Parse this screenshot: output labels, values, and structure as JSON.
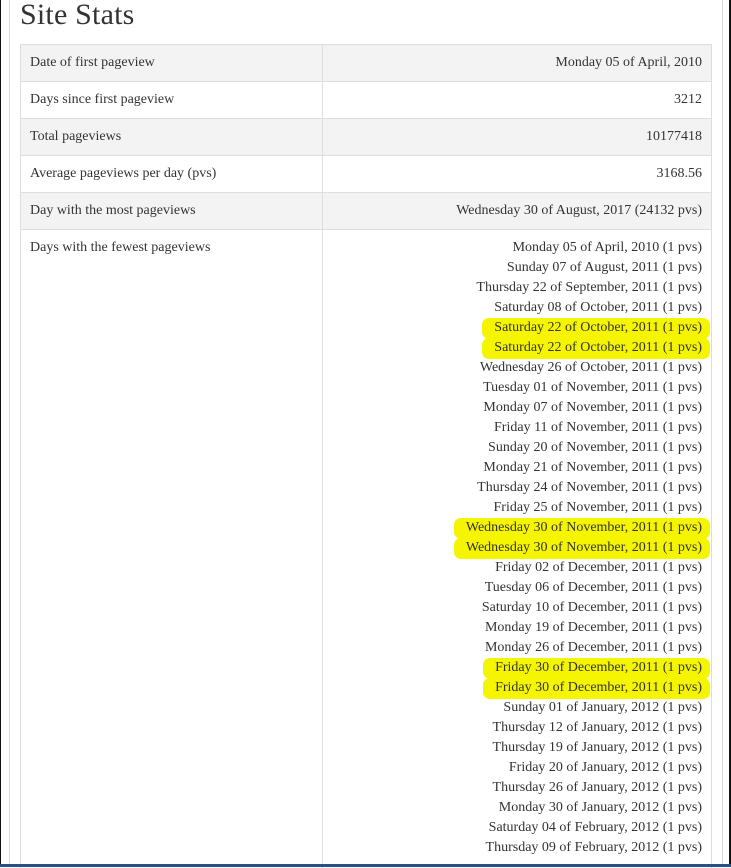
{
  "page_title": "Site Stats",
  "stats": [
    {
      "label": "Date of first pageview",
      "value": "Monday 05 of April, 2010"
    },
    {
      "label": "Days since first pageview",
      "value": "3212"
    },
    {
      "label": "Total pageviews",
      "value": "10177418"
    },
    {
      "label": "Average pageviews per day (pvs)",
      "value": "3168.56"
    },
    {
      "label": "Day with the most pageviews",
      "value": "Wednesday 30 of August, 2017 (24132 pvs)"
    }
  ],
  "fewest": {
    "label": "Days with the fewest pageviews",
    "days": [
      "Monday 05 of April, 2010 (1 pvs)",
      "Sunday 07 of August, 2011 (1 pvs)",
      "Thursday 22 of September, 2011 (1 pvs)",
      "Saturday 08 of October, 2011 (1 pvs)",
      "Saturday 22 of October, 2011 (1 pvs)",
      "Saturday 22 of October, 2011 (1 pvs)",
      "Wednesday 26 of October, 2011 (1 pvs)",
      "Tuesday 01 of November, 2011 (1 pvs)",
      "Monday 07 of November, 2011 (1 pvs)",
      "Friday 11 of November, 2011 (1 pvs)",
      "Sunday 20 of November, 2011 (1 pvs)",
      "Monday 21 of November, 2011 (1 pvs)",
      "Thursday 24 of November, 2011 (1 pvs)",
      "Friday 25 of November, 2011 (1 pvs)",
      "Wednesday 30 of November, 2011 (1 pvs)",
      "Wednesday 30 of November, 2011 (1 pvs)",
      "Friday 02 of December, 2011 (1 pvs)",
      "Tuesday 06 of December, 2011 (1 pvs)",
      "Saturday 10 of December, 2011 (1 pvs)",
      "Monday 19 of December, 2011 (1 pvs)",
      "Monday 26 of December, 2011 (1 pvs)",
      "Friday 30 of December, 2011 (1 pvs)",
      "Friday 30 of December, 2011 (1 pvs)",
      "Sunday 01 of January, 2012 (1 pvs)",
      "Thursday 12 of January, 2012 (1 pvs)",
      "Thursday 19 of January, 2012 (1 pvs)",
      "Friday 20 of January, 2012 (1 pvs)",
      "Thursday 26 of January, 2012 (1 pvs)",
      "Monday 30 of January, 2012 (1 pvs)",
      "Saturday 04 of February, 2012 (1 pvs)",
      "Thursday 09 of February, 2012 (1 pvs)"
    ],
    "highlighted_indices": [
      4,
      5,
      14,
      15,
      21,
      22
    ],
    "highlight_color": "#f5f500"
  },
  "colors": {
    "row_alt": "#f3f3f3",
    "border": "#dedede",
    "text": "#333333",
    "taskbar": "#2a4f8a"
  }
}
